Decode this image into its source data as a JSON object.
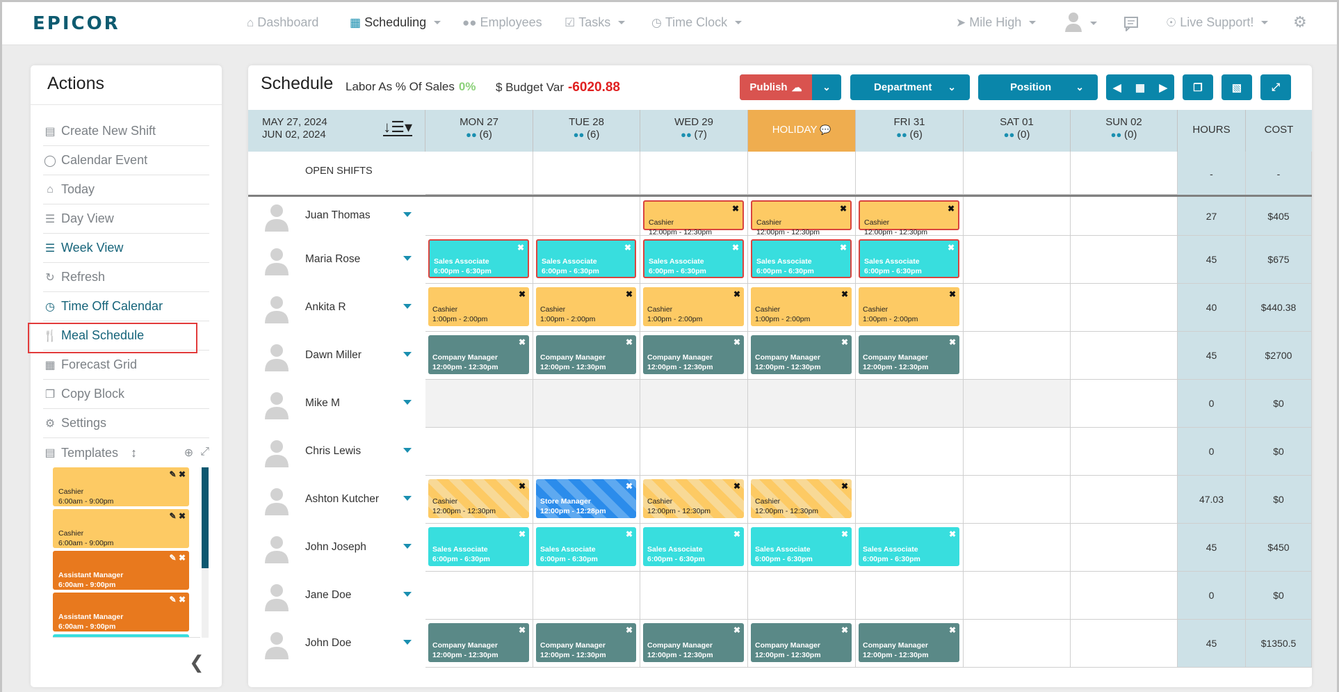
{
  "app": {
    "logo": "EPICOR",
    "nav": [
      {
        "label": "Dashboard",
        "icon": "home-icon",
        "active": false,
        "dropdown": false
      },
      {
        "label": "Scheduling",
        "icon": "calendar-icon",
        "active": true,
        "dropdown": true
      },
      {
        "label": "Employees",
        "icon": "users-icon",
        "active": false,
        "dropdown": false
      },
      {
        "label": "Tasks",
        "icon": "checkbox-icon",
        "active": false,
        "dropdown": true
      },
      {
        "label": "Time Clock",
        "icon": "clock-icon",
        "active": false,
        "dropdown": true
      }
    ],
    "right_nav": {
      "location": "Mile High",
      "support": "Live Support!"
    }
  },
  "actions": {
    "title": "Actions",
    "items": [
      {
        "label": "Create New Shift",
        "icon": "copy-file-icon"
      },
      {
        "label": "Calendar Event",
        "icon": "comment-icon"
      },
      {
        "label": "Today",
        "icon": "home-icon"
      },
      {
        "label": "Day View",
        "icon": "list-icon"
      },
      {
        "label": "Week View",
        "icon": "bars-icon"
      },
      {
        "label": "Refresh",
        "icon": "refresh-icon"
      },
      {
        "label": "Time Off Calendar",
        "icon": "clock-icon"
      },
      {
        "label": "Meal Schedule",
        "icon": "cutlery-icon"
      },
      {
        "label": "Forecast Grid",
        "icon": "grid-icon"
      },
      {
        "label": "Copy Block",
        "icon": "copy-icon"
      },
      {
        "label": "Settings",
        "icon": "cogs-icon"
      }
    ],
    "templates_label": "Templates",
    "templates": [
      {
        "role": "Cashier",
        "time": "6:00am - 9:00pm",
        "type": "cashier"
      },
      {
        "role": "Cashier",
        "time": "6:00am - 9:00pm",
        "type": "cashier"
      },
      {
        "role": "Assistant Manager",
        "time": "6:00am - 9:00pm",
        "type": "asst"
      },
      {
        "role": "Assistant Manager",
        "time": "6:00am - 9:00pm",
        "type": "asst"
      },
      {
        "role": "",
        "time": "",
        "type": "sales"
      }
    ]
  },
  "schedule": {
    "title": "Schedule",
    "labor_label": "Labor As % Of Sales",
    "labor_value": "0%",
    "budget_label": "$ Budget Var",
    "budget_value": "-6020.88",
    "publish_label": "Publish",
    "department_label": "Department",
    "position_label": "Position",
    "date_start": "MAY 27, 2024",
    "date_end": "JUN 02, 2024",
    "days": [
      {
        "label": "MON 27",
        "count": "(6)",
        "holiday": false
      },
      {
        "label": "TUE 28",
        "count": "(6)",
        "holiday": false
      },
      {
        "label": "WED 29",
        "count": "(7)",
        "holiday": false
      },
      {
        "label": "HOLIDAY",
        "count": "",
        "holiday": true
      },
      {
        "label": "FRI 31",
        "count": "(6)",
        "holiday": false
      },
      {
        "label": "SAT 01",
        "count": "(0)",
        "holiday": false
      },
      {
        "label": "SUN 02",
        "count": "(0)",
        "holiday": false
      }
    ],
    "hours_label": "HOURS",
    "cost_label": "COST",
    "open_shifts": {
      "label": "OPEN SHIFTS",
      "hours": "-",
      "cost": "-"
    },
    "employees": [
      {
        "name": "Juan Thomas",
        "hours": "27",
        "cost": "$405",
        "gray": false,
        "shifts": [
          null,
          null,
          {
            "role": "Cashier",
            "time": "12:00pm - 12:30pm",
            "type": "cashier",
            "warn": true
          },
          {
            "role": "Cashier",
            "time": "12:00pm - 12:30pm",
            "type": "cashier",
            "warn": true
          },
          {
            "role": "Cashier",
            "time": "12:00pm - 12:30pm",
            "type": "cashier",
            "warn": true
          },
          null,
          null
        ]
      },
      {
        "name": "Maria Rose",
        "hours": "45",
        "cost": "$675",
        "gray": false,
        "shifts": [
          {
            "role": "Sales Associate",
            "time": "6:00pm - 6:30pm",
            "type": "sales",
            "warn": true
          },
          {
            "role": "Sales Associate",
            "time": "6:00pm - 6:30pm",
            "type": "sales",
            "warn": true
          },
          {
            "role": "Sales Associate",
            "time": "6:00pm - 6:30pm",
            "type": "sales",
            "warn": true
          },
          {
            "role": "Sales Associate",
            "time": "6:00pm - 6:30pm",
            "type": "sales",
            "warn": true
          },
          {
            "role": "Sales Associate",
            "time": "6:00pm - 6:30pm",
            "type": "sales",
            "warn": true
          },
          null,
          null
        ]
      },
      {
        "name": "Ankita R",
        "hours": "40",
        "cost": "$440.38",
        "gray": false,
        "shifts": [
          {
            "role": "Cashier",
            "time": "1:00pm - 2:00pm",
            "type": "cashier"
          },
          {
            "role": "Cashier",
            "time": "1:00pm - 2:00pm",
            "type": "cashier"
          },
          {
            "role": "Cashier",
            "time": "1:00pm - 2:00pm",
            "type": "cashier"
          },
          {
            "role": "Cashier",
            "time": "1:00pm - 2:00pm",
            "type": "cashier"
          },
          {
            "role": "Cashier",
            "time": "1:00pm - 2:00pm",
            "type": "cashier"
          },
          null,
          null
        ]
      },
      {
        "name": "Dawn Miller",
        "hours": "45",
        "cost": "$2700",
        "gray": false,
        "shifts": [
          {
            "role": "Company Manager",
            "time": "12:00pm - 12:30pm",
            "type": "mgr"
          },
          {
            "role": "Company Manager",
            "time": "12:00pm - 12:30pm",
            "type": "mgr"
          },
          {
            "role": "Company Manager",
            "time": "12:00pm - 12:30pm",
            "type": "mgr"
          },
          {
            "role": "Company Manager",
            "time": "12:00pm - 12:30pm",
            "type": "mgr"
          },
          {
            "role": "Company Manager",
            "time": "12:00pm - 12:30pm",
            "type": "mgr"
          },
          null,
          null
        ]
      },
      {
        "name": "Mike M",
        "hours": "0",
        "cost": "$0",
        "gray": true,
        "shifts": [
          null,
          null,
          null,
          null,
          null,
          null,
          null
        ]
      },
      {
        "name": "Chris Lewis",
        "hours": "0",
        "cost": "$0",
        "gray": false,
        "shifts": [
          null,
          null,
          null,
          null,
          null,
          null,
          null
        ]
      },
      {
        "name": "Ashton Kutcher",
        "hours": "47.03",
        "cost": "$0",
        "gray": false,
        "shifts": [
          {
            "role": "Cashier",
            "time": "12:00pm - 12:30pm",
            "type": "cashier",
            "striped": true
          },
          {
            "role": "Store Manager",
            "time": "12:00pm - 12:28pm",
            "type": "store"
          },
          {
            "role": "Cashier",
            "time": "12:00pm - 12:30pm",
            "type": "cashier",
            "striped": true
          },
          {
            "role": "Cashier",
            "time": "12:00pm - 12:30pm",
            "type": "cashier",
            "striped": true
          },
          null,
          null,
          null
        ]
      },
      {
        "name": "John Joseph",
        "hours": "45",
        "cost": "$450",
        "gray": false,
        "shifts": [
          {
            "role": "Sales Associate",
            "time": "6:00pm - 6:30pm",
            "type": "sales"
          },
          {
            "role": "Sales Associate",
            "time": "6:00pm - 6:30pm",
            "type": "sales"
          },
          {
            "role": "Sales Associate",
            "time": "6:00pm - 6:30pm",
            "type": "sales"
          },
          {
            "role": "Sales Associate",
            "time": "6:00pm - 6:30pm",
            "type": "sales"
          },
          {
            "role": "Sales Associate",
            "time": "6:00pm - 6:30pm",
            "type": "sales"
          },
          null,
          null
        ]
      },
      {
        "name": "Jane Doe",
        "hours": "0",
        "cost": "$0",
        "gray": false,
        "shifts": [
          null,
          null,
          null,
          null,
          null,
          null,
          null
        ]
      },
      {
        "name": "John Doe",
        "hours": "45",
        "cost": "$1350.5",
        "gray": false,
        "shifts": [
          {
            "role": "Company Manager",
            "time": "12:00pm - 12:30pm",
            "type": "mgr"
          },
          {
            "role": "Company Manager",
            "time": "12:00pm - 12:30pm",
            "type": "mgr"
          },
          {
            "role": "Company Manager",
            "time": "12:00pm - 12:30pm",
            "type": "mgr"
          },
          {
            "role": "Company Manager",
            "time": "12:00pm - 12:30pm",
            "type": "mgr"
          },
          {
            "role": "Company Manager",
            "time": "12:00pm - 12:30pm",
            "type": "mgr"
          },
          null,
          null
        ]
      }
    ]
  },
  "colors": {
    "brand": "#0e5b70",
    "accent": "#0a86aa",
    "publish": "#d9534f",
    "holiday": "#efad4f",
    "header_bg": "#cde1e7",
    "cashier": "#fdca64",
    "sales": "#38dede",
    "manager": "#5a8987",
    "store_manager": "#2b8ceb",
    "assistant_manager": "#e8791e",
    "budget_negative": "#e02121",
    "labor_positive": "#8cd17a"
  }
}
